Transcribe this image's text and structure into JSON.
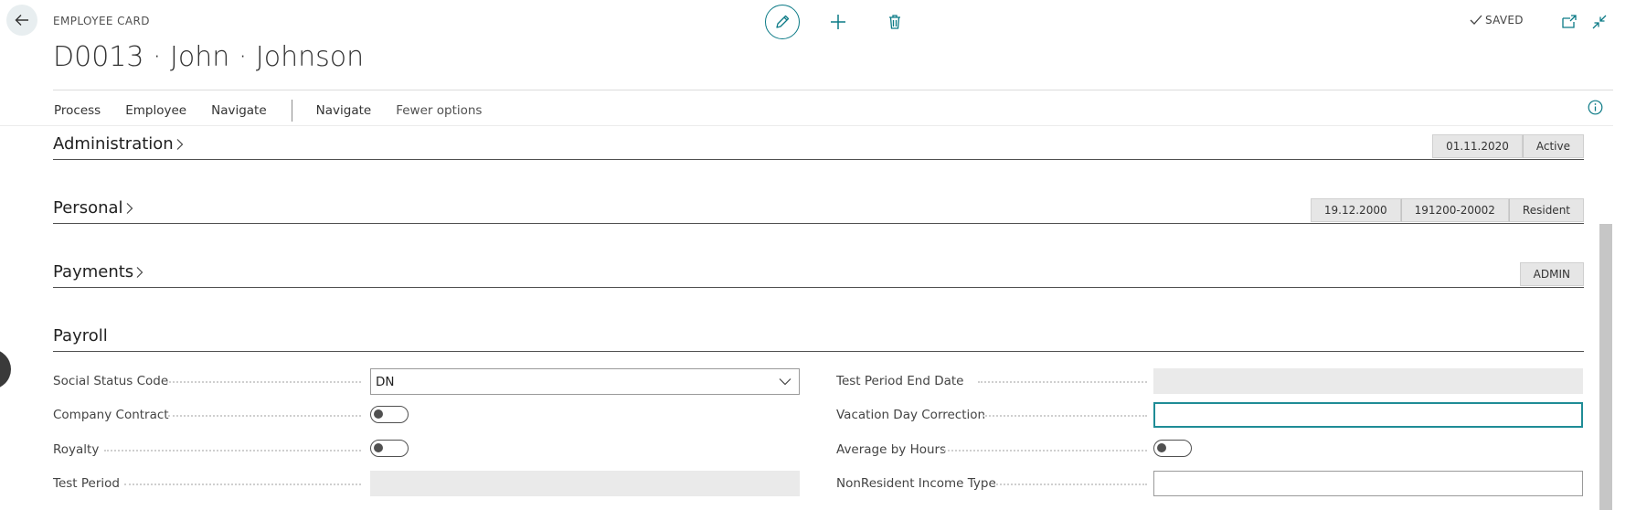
{
  "header": {
    "page_type": "EMPLOYEE CARD",
    "title": "D0013 · John · Johnson",
    "saved_label": "SAVED"
  },
  "actions": {
    "process": "Process",
    "employee": "Employee",
    "navigate_1": "Navigate",
    "navigate_2": "Navigate",
    "fewer_options": "Fewer options"
  },
  "sections": {
    "administration": {
      "title": "Administration",
      "chips": [
        "01.11.2020",
        "Active"
      ]
    },
    "personal": {
      "title": "Personal",
      "chips": [
        "19.12.2000",
        "191200-20002",
        "Resident"
      ]
    },
    "payments": {
      "title": "Payments",
      "chips": [
        "ADMIN"
      ]
    },
    "payroll": {
      "title": "Payroll"
    }
  },
  "payroll": {
    "social_status_code": {
      "label": "Social Status Code",
      "value": "DN"
    },
    "company_contract": {
      "label": "Company Contract",
      "checked": false
    },
    "royalty": {
      "label": "Royalty",
      "checked": false
    },
    "test_period": {
      "label": "Test Period",
      "value": ""
    },
    "test_period_end_date": {
      "label": "Test Period End Date",
      "value": ""
    },
    "vacation_day_correction": {
      "label": "Vacation Day Correction",
      "value": ""
    },
    "average_by_hours": {
      "label": "Average by Hours",
      "checked": false
    },
    "nonresident_income_type": {
      "label": "NonResident Income Type",
      "value": ""
    }
  },
  "icons": {
    "back": "back-arrow-icon",
    "edit": "pencil-icon",
    "new": "plus-icon",
    "delete": "trash-icon",
    "saved": "checkmark-icon",
    "open_new_window": "open-new-window-icon",
    "collapse": "collapse-icon",
    "info": "info-icon"
  },
  "colors": {
    "accent": "#0b7a86",
    "focus_border": "#1f8c96",
    "chip_bg": "#e6e6e6",
    "readonly_bg": "#eaeaea"
  }
}
